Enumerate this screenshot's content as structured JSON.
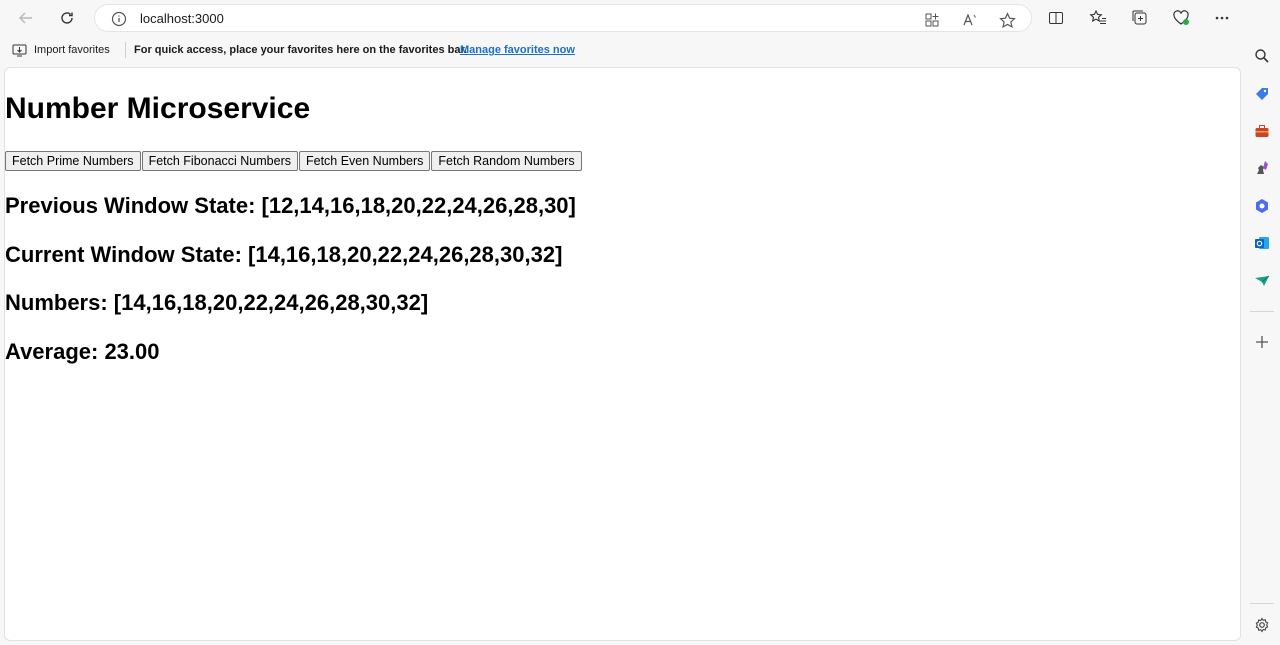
{
  "browser": {
    "url": "localhost:3000",
    "favorites_bar": {
      "import_label": "Import favorites",
      "message": "For quick access, place your favorites here on the favorites bar.",
      "link_label": "Manage favorites now"
    },
    "toolbar_icons": [
      "back-icon",
      "refresh-icon",
      "site-info-icon",
      "app-available-icon",
      "read-aloud-icon",
      "favorite-star-icon",
      "split-screen-icon",
      "favorites-icon",
      "collections-icon",
      "browser-essentials-icon",
      "more-icon",
      "copilot-icon"
    ],
    "sidebar_icons": [
      "search-icon",
      "shopping-icon",
      "tools-icon",
      "games-icon",
      "microsoft-365-icon",
      "outlook-icon",
      "drop-icon",
      "add-icon",
      "settings-icon"
    ],
    "colors": {
      "link": "#1b6fc9",
      "outlook": "#0a64c8",
      "copilot": "#1f8ae8"
    }
  },
  "page": {
    "title": "Number Microservice",
    "buttons": [
      "Fetch Prime Numbers",
      "Fetch Fibonacci Numbers",
      "Fetch Even Numbers",
      "Fetch Random Numbers"
    ],
    "previous_window_state": "Previous Window State: [12,14,16,18,20,22,24,26,28,30]",
    "current_window_state": "Current Window State: [14,16,18,20,22,24,26,28,30,32]",
    "numbers": "Numbers: [14,16,18,20,22,24,26,28,30,32]",
    "average": "Average: 23.00"
  }
}
